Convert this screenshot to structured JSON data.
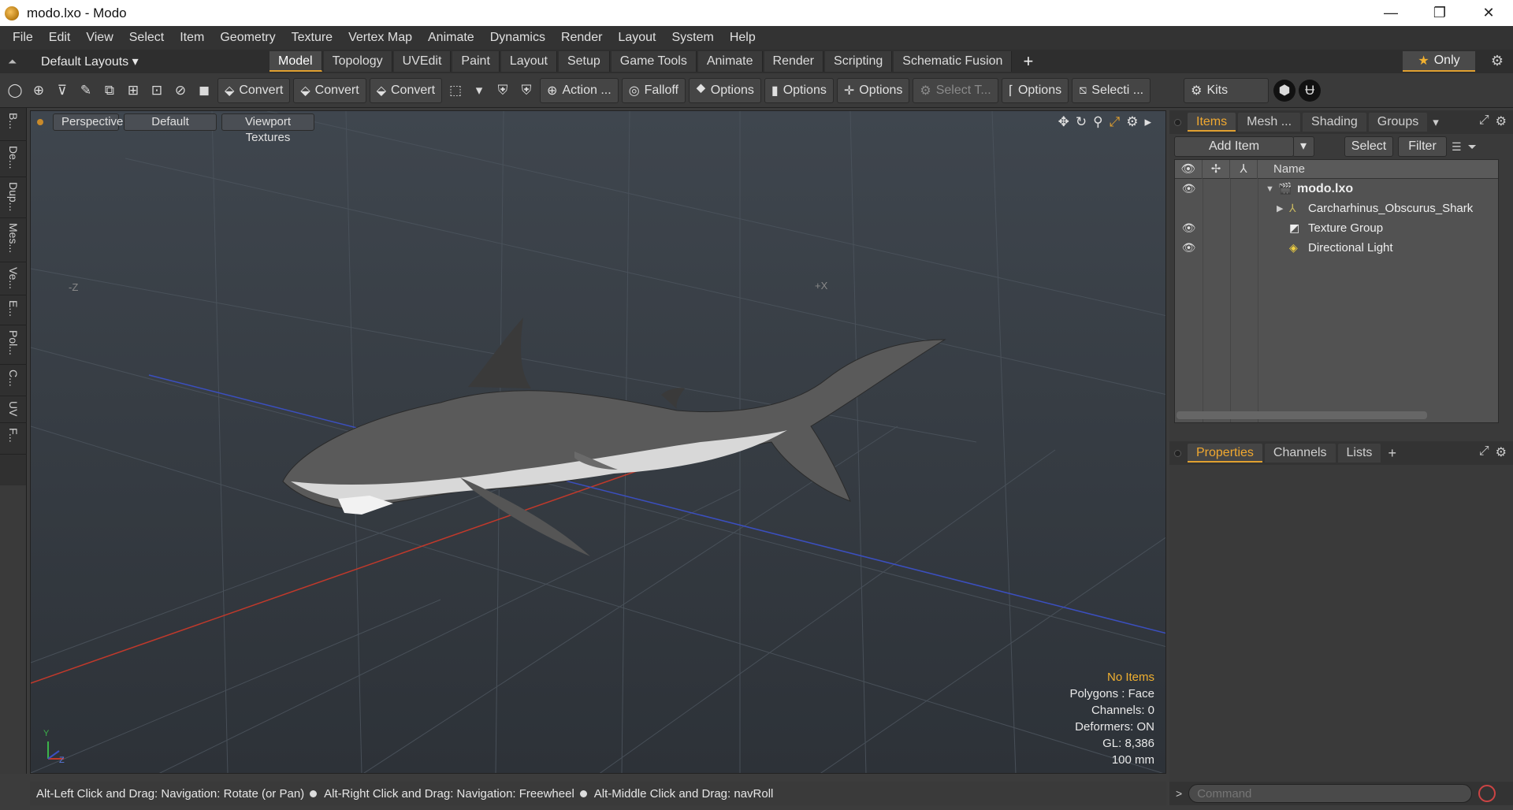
{
  "window": {
    "title": "modo.lxo - Modo",
    "minimize_glyph": "—",
    "restore_glyph": "❐",
    "close_glyph": "✕"
  },
  "menus": [
    "File",
    "Edit",
    "View",
    "Select",
    "Item",
    "Geometry",
    "Texture",
    "Vertex Map",
    "Animate",
    "Dynamics",
    "Render",
    "Layout",
    "System",
    "Help"
  ],
  "layout_bar": {
    "layouts_label": "Default Layouts ▾",
    "tabs": [
      "Model",
      "Topology",
      "UVEdit",
      "Paint",
      "Layout",
      "Setup",
      "Game Tools",
      "Animate",
      "Render",
      "Scripting",
      "Schematic Fusion"
    ],
    "active_tab": "Model",
    "plus": "+",
    "only_label": "Only"
  },
  "toolbar": {
    "convert1": "Convert",
    "convert2": "Convert",
    "convert3": "Convert",
    "action": "Action ...",
    "falloff": "Falloff",
    "options1": "Options",
    "options2": "Options",
    "options3": "Options",
    "select_t": "Select T...",
    "options4": "Options",
    "selecti": "Selecti ...",
    "kits": "Kits"
  },
  "left_tabs": [
    "B...",
    "De...",
    "Dup...",
    "Mes...",
    "Ve...",
    "E...",
    "Pol...",
    "C...",
    "UV",
    "F..."
  ],
  "viewport": {
    "view_mode": "Perspective",
    "shading": "Default",
    "textures": "Viewport Textures",
    "axis_neg_z": "-Z",
    "axis_pos_x": "+X",
    "info": {
      "no_items": "No Items",
      "polygons": "Polygons : Face",
      "channels": "Channels: 0",
      "deformers": "Deformers: ON",
      "gl": "GL: 8,386",
      "scale": "100 mm"
    },
    "gizmo_y": "Y",
    "gizmo_z": "Z"
  },
  "statusbar": {
    "hint1": "Alt-Left Click and Drag: Navigation: Rotate (or Pan)",
    "hint2": "Alt-Right Click and Drag: Navigation: Freewheel",
    "hint3": "Alt-Middle Click and Drag: navRoll"
  },
  "items_panel": {
    "tabs": [
      "Items",
      "Mesh ...",
      "Shading",
      "Groups"
    ],
    "active_tab": "Items",
    "add_item": "Add Item",
    "select": "Select",
    "filter": "Filter",
    "name_header": "Name",
    "rows": [
      {
        "name": "modo.lxo",
        "visible": true,
        "expanded": true,
        "level": 0
      },
      {
        "name": "Carcharhinus_Obscurus_Shark",
        "visible": false,
        "expanded": false,
        "level": 1
      },
      {
        "name": "Texture Group",
        "visible": true,
        "expanded": null,
        "level": 1
      },
      {
        "name": "Directional Light",
        "visible": true,
        "expanded": null,
        "level": 1
      }
    ]
  },
  "properties_panel": {
    "tabs": [
      "Properties",
      "Channels",
      "Lists"
    ],
    "active_tab": "Properties",
    "plus": "+"
  },
  "command": {
    "placeholder": "Command"
  },
  "colors": {
    "accent": "#e0a030",
    "viewport_bg": "#3a4047",
    "x_axis": "#c0392b",
    "z_axis": "#3b4fbf"
  }
}
